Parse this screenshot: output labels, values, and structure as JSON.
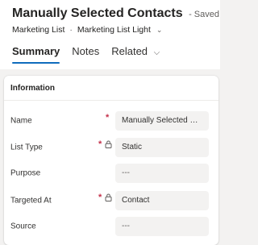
{
  "header": {
    "title": "Manually Selected Contacts",
    "saved_status": "- Saved",
    "entity": "Marketing List",
    "separator": "·",
    "form_name": "Marketing List Light",
    "form_chevron": "⌄"
  },
  "tabs": [
    {
      "label": "Summary",
      "active": true
    },
    {
      "label": "Notes",
      "active": false
    },
    {
      "label": "Related",
      "active": false,
      "chevron": "⌵"
    }
  ],
  "section": {
    "title": "Information",
    "fields": [
      {
        "label": "Name",
        "required": true,
        "locked": false,
        "value": "Manually Selected Contacts"
      },
      {
        "label": "List Type",
        "required": true,
        "locked": true,
        "value": "Static"
      },
      {
        "label": "Purpose",
        "required": false,
        "locked": false,
        "value": "---"
      },
      {
        "label": "Targeted At",
        "required": true,
        "locked": true,
        "value": "Contact"
      },
      {
        "label": "Source",
        "required": false,
        "locked": false,
        "value": "---"
      }
    ],
    "required_marker": "*"
  },
  "colors": {
    "accent": "#0f6cbd",
    "required": "#c4314b",
    "background": "#f3f2f1",
    "field_bg": "#f3f2f1"
  },
  "icons": {
    "lock": "lock-icon",
    "chevron": "chevron-down-icon"
  }
}
